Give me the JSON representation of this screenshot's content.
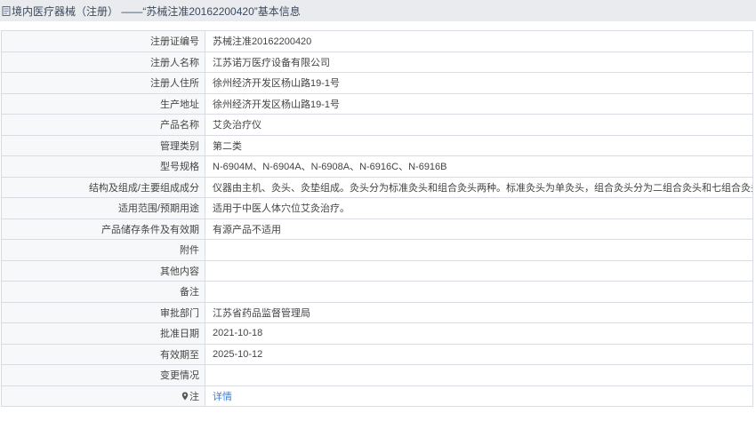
{
  "header": {
    "title": "境内医疗器械（注册） ——“苏械注准20162200420”基本信息"
  },
  "rows": [
    {
      "label": "注册证编号",
      "value": "苏械注准20162200420"
    },
    {
      "label": "注册人名称",
      "value": "江苏诺万医疗设备有限公司"
    },
    {
      "label": "注册人住所",
      "value": "徐州经济开发区杨山路19-1号"
    },
    {
      "label": "生产地址",
      "value": "徐州经济开发区杨山路19-1号"
    },
    {
      "label": "产品名称",
      "value": "艾灸治疗仪"
    },
    {
      "label": "管理类别",
      "value": "第二类"
    },
    {
      "label": "型号规格",
      "value": "N-6904M、N-6904A、N-6908A、N-6916C、N-6916B"
    },
    {
      "label": "结构及组成/主要组成成分",
      "value": "仪器由主机、灸头、灸垫组成。灸头分为标准灸头和组合灸头两种。标准灸头为单灸头，组合灸头分为二组合灸头和七组合灸头。"
    },
    {
      "label": "适用范围/预期用途",
      "value": "适用于中医人体穴位艾灸治疗。"
    },
    {
      "label": "产品储存条件及有效期",
      "value": "有源产品不适用"
    },
    {
      "label": "附件",
      "value": ""
    },
    {
      "label": "其他内容",
      "value": ""
    },
    {
      "label": "备注",
      "value": ""
    },
    {
      "label": "审批部门",
      "value": "江苏省药品监督管理局"
    },
    {
      "label": "批准日期",
      "value": "2021-10-18"
    },
    {
      "label": "有效期至",
      "value": "2025-10-12"
    },
    {
      "label": "变更情况",
      "value": ""
    }
  ],
  "note_row": {
    "icon": "map-pin-icon",
    "label": "注",
    "link_text": "详情"
  },
  "colors": {
    "header_bg": "#e9ebee",
    "label_bg": "#f7f8f9",
    "border": "#d9dde3",
    "link": "#3b7dd8",
    "text": "#444444"
  }
}
